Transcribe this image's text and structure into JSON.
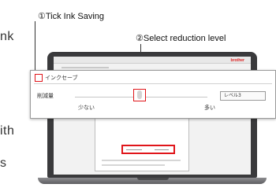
{
  "side_text": {
    "line1_fragment": "nk",
    "line2_fragment": "ith",
    "line3_fragment": "s"
  },
  "callouts": {
    "step1": "①Tick Ink Saving",
    "step2": "②Select reduction level"
  },
  "screen": {
    "brand": "brother"
  },
  "zoom_panel": {
    "ink_save_label": "インクセーブ",
    "level_label": "削減量",
    "low_label": "少ない",
    "high_label": "多い",
    "level_value": "レベル3"
  },
  "colors": {
    "highlight": "#e0151a"
  }
}
